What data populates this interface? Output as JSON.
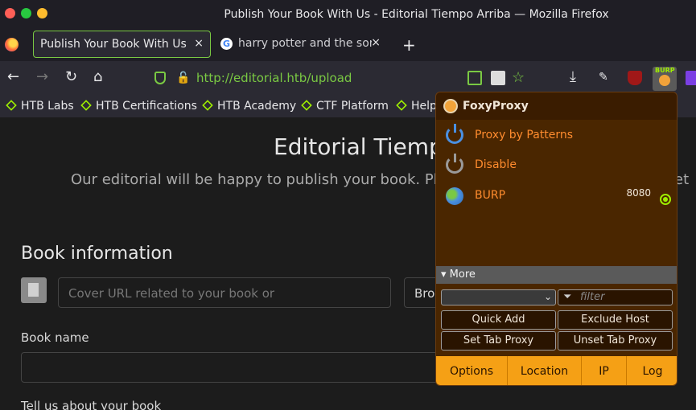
{
  "window": {
    "title": "Publish Your Book With Us - Editorial Tiempo Arriba — Mozilla Firefox"
  },
  "tabs": [
    {
      "label": "Publish Your Book With Us - E",
      "close": "×"
    },
    {
      "label": "harry potter and the sorce",
      "close": "×"
    }
  ],
  "new_tab_label": "+",
  "nav": {
    "back": "←",
    "forward": "→",
    "reload": "↻",
    "home": "⌂",
    "url_prefix": "http://",
    "url_host": "editorial.htb",
    "url_path": "/upload",
    "burp_badge": "BURP"
  },
  "bookmarks": [
    "HTB Labs",
    "HTB Certifications",
    "HTB Academy",
    "CTF Platform",
    "Help"
  ],
  "page": {
    "title": "Editorial Tiempo",
    "subtitle": "Our editorial will be happy to publish your book. Plea",
    "subtitle_tail": "et",
    "section_title": "Book information",
    "cover_placeholder": "Cover URL related to your book or",
    "browse_label": "Bro",
    "book_name_label": "Book name",
    "tell_label": "Tell us about your book"
  },
  "foxyproxy": {
    "title": "FoxyProxy",
    "items": [
      {
        "label": "Proxy by Patterns"
      },
      {
        "label": "Disable"
      },
      {
        "label": "BURP",
        "port": "8080"
      }
    ],
    "more_label": "▾ More",
    "filter_placeholder": "filter",
    "buttons": [
      "Quick Add",
      "Exclude Host",
      "Set Tab Proxy",
      "Unset Tab Proxy"
    ],
    "footer": [
      "Options",
      "Location",
      "IP",
      "Log"
    ]
  }
}
